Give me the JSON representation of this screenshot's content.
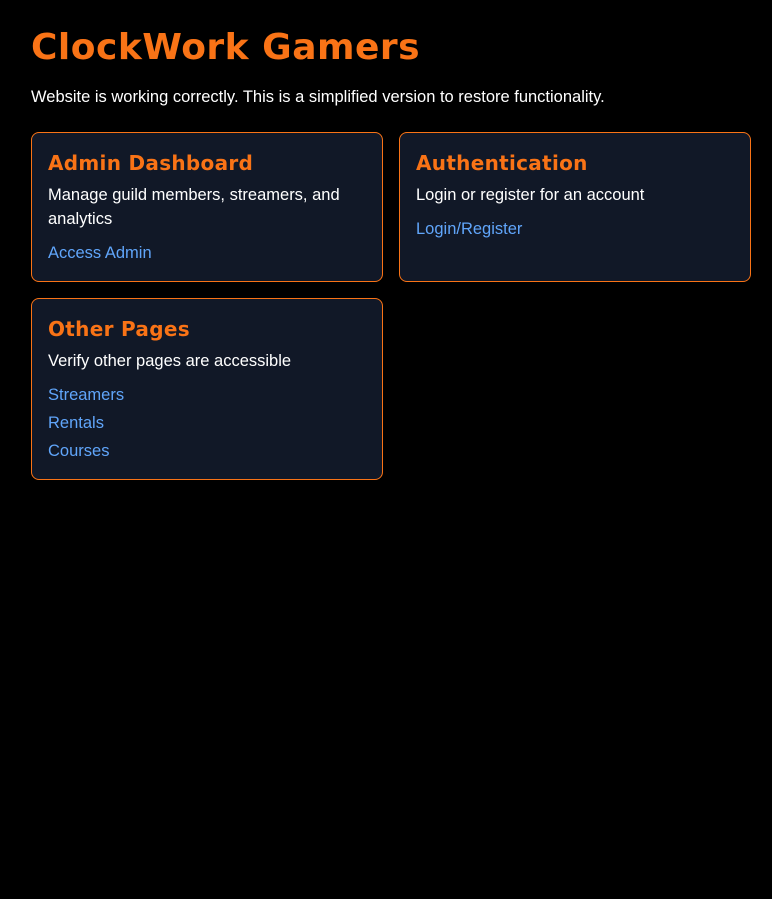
{
  "header": {
    "title": "ClockWork Gamers",
    "intro": "Website is working correctly. This is a simplified version to restore functionality."
  },
  "cards": {
    "admin": {
      "title": "Admin Dashboard",
      "description": "Manage guild members, streamers, and analytics",
      "links": [
        "Access Admin"
      ]
    },
    "auth": {
      "title": "Authentication",
      "description": "Login or register for an account",
      "links": [
        "Login/Register"
      ]
    },
    "other": {
      "title": "Other Pages",
      "description": "Verify other pages are accessible",
      "links": [
        "Streamers",
        "Rentals",
        "Courses"
      ]
    }
  },
  "colors": {
    "background": "#000000",
    "accent": "#f97316",
    "card_background": "#111827",
    "link": "#60a5fa",
    "text": "#ffffff"
  }
}
